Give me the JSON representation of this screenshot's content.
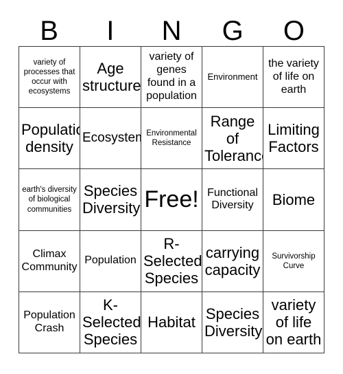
{
  "header": {
    "letters": [
      "B",
      "I",
      "N",
      "G",
      "O"
    ]
  },
  "grid": {
    "rows": [
      [
        {
          "text": "variety of processes that occur with ecosystems",
          "size": "fs-xs"
        },
        {
          "text": "Age structure",
          "size": "fs-xl"
        },
        {
          "text": "variety of genes found in a population",
          "size": "fs-md"
        },
        {
          "text": "Environment",
          "size": "fs-sm"
        },
        {
          "text": "the variety of life on earth",
          "size": "fs-md"
        }
      ],
      [
        {
          "text": "Population density",
          "size": "fs-xl"
        },
        {
          "text": "Ecosystems",
          "size": "fs-lg"
        },
        {
          "text": "Environmental Resistance",
          "size": "fs-xs"
        },
        {
          "text": "Range of Tolerance",
          "size": "fs-xl"
        },
        {
          "text": "Limiting Factors",
          "size": "fs-xl"
        }
      ],
      [
        {
          "text": "earth's diversity of biological communities",
          "size": "fs-xs"
        },
        {
          "text": "Species Diversity",
          "size": "fs-xl"
        },
        {
          "text": "Free!",
          "size": "fs-free"
        },
        {
          "text": "Functional Diversity",
          "size": "fs-md"
        },
        {
          "text": "Biome",
          "size": "fs-xl"
        }
      ],
      [
        {
          "text": "Climax Community",
          "size": "fs-md"
        },
        {
          "text": "Population",
          "size": "fs-md"
        },
        {
          "text": "R-\nSelected Species",
          "size": "fs-xl"
        },
        {
          "text": "carrying capacity",
          "size": "fs-xl"
        },
        {
          "text": "Survivorship Curve",
          "size": "fs-xs"
        }
      ],
      [
        {
          "text": "Population Crash",
          "size": "fs-md"
        },
        {
          "text": "K-\nSelected Species",
          "size": "fs-xl"
        },
        {
          "text": "Habitat",
          "size": "fs-xl"
        },
        {
          "text": "Species Diversity",
          "size": "fs-xl"
        },
        {
          "text": "variety of life on earth",
          "size": "fs-xl"
        }
      ]
    ]
  }
}
